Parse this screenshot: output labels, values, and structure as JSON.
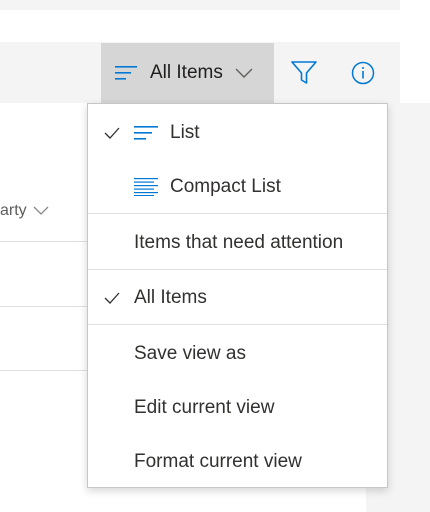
{
  "toolbar": {
    "view_label": "All Items"
  },
  "list": {
    "column_header_partial": "arty"
  },
  "view_menu": {
    "items": [
      {
        "label": "List",
        "checked": true,
        "icon": "list-lines-icon"
      },
      {
        "label": "Compact List",
        "checked": false,
        "icon": "compact-list-icon"
      },
      {
        "label": "Items that need attention",
        "checked": false
      },
      {
        "label": "All Items",
        "checked": true
      },
      {
        "label": "Save view as",
        "checked": false
      },
      {
        "label": "Edit current view",
        "checked": false
      },
      {
        "label": "Format current view",
        "checked": false
      }
    ]
  },
  "colors": {
    "accent": "#0078d4",
    "button_active_bg": "#d6d6d6",
    "text": "#323130",
    "muted": "#605e5c"
  }
}
